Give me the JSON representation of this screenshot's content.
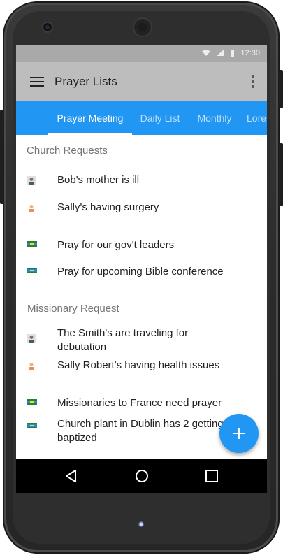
{
  "status_bar": {
    "time": "12:30"
  },
  "app_bar": {
    "title": "Prayer Lists"
  },
  "tabs": [
    {
      "label": "Prayer Meeting",
      "active": true
    },
    {
      "label": "Daily List",
      "active": false
    },
    {
      "label": "Monthly",
      "active": false
    },
    {
      "label": "Lore",
      "active": false
    }
  ],
  "sections": [
    {
      "header": "Church Requests",
      "group1": [
        {
          "text": "Bob's mother is ill",
          "icon": "male-avatar-icon"
        },
        {
          "text": "Sally's having surgery",
          "icon": "female-avatar-icon"
        }
      ],
      "group2": [
        {
          "text": "Pray for our gov't leaders",
          "icon": "flag-icon"
        },
        {
          "text": "Pray for upcoming Bible conference",
          "icon": "flag-icon"
        }
      ]
    },
    {
      "header": "Missionary Request",
      "group1": [
        {
          "text": "The Smith's are traveling for debutation",
          "icon": "male-avatar-icon"
        },
        {
          "text": "Sally Robert's having health issues",
          "icon": "female-avatar-icon"
        }
      ],
      "group2": [
        {
          "text": "Missionaries to France need prayer",
          "icon": "flag-icon"
        },
        {
          "text": "Church plant in Dublin has 2 getting baptized",
          "icon": "flag-icon"
        }
      ]
    }
  ],
  "fab": {
    "icon": "plus-icon"
  },
  "colors": {
    "primary": "#2196f3",
    "app_bar": "#bdbdbd",
    "status_bar": "#a9a9a9"
  }
}
